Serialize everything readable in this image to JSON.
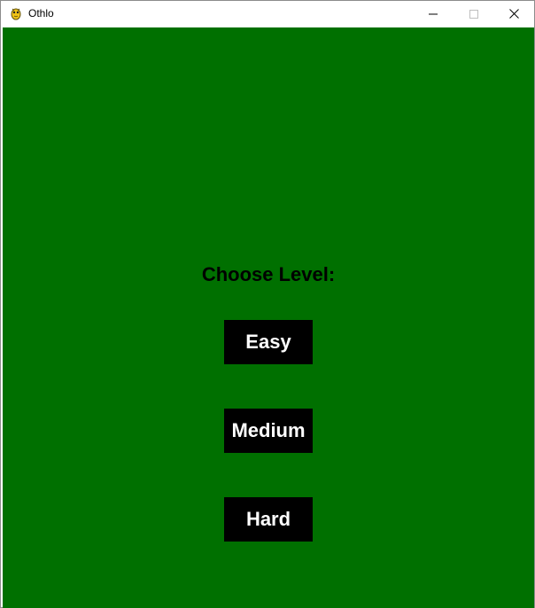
{
  "window": {
    "title": "Othlo",
    "icon": "pygame-snake-icon",
    "controls": {
      "minimize_icon": "minimize-icon",
      "maximize_icon": "maximize-icon",
      "close_icon": "close-icon"
    }
  },
  "colors": {
    "background": "#007000",
    "button_bg": "#000000",
    "button_text": "#ffffff",
    "heading_text": "#000000"
  },
  "menu": {
    "heading": "Choose Level:",
    "levels": [
      {
        "label": "Easy"
      },
      {
        "label": "Medium"
      },
      {
        "label": "Hard"
      }
    ]
  }
}
